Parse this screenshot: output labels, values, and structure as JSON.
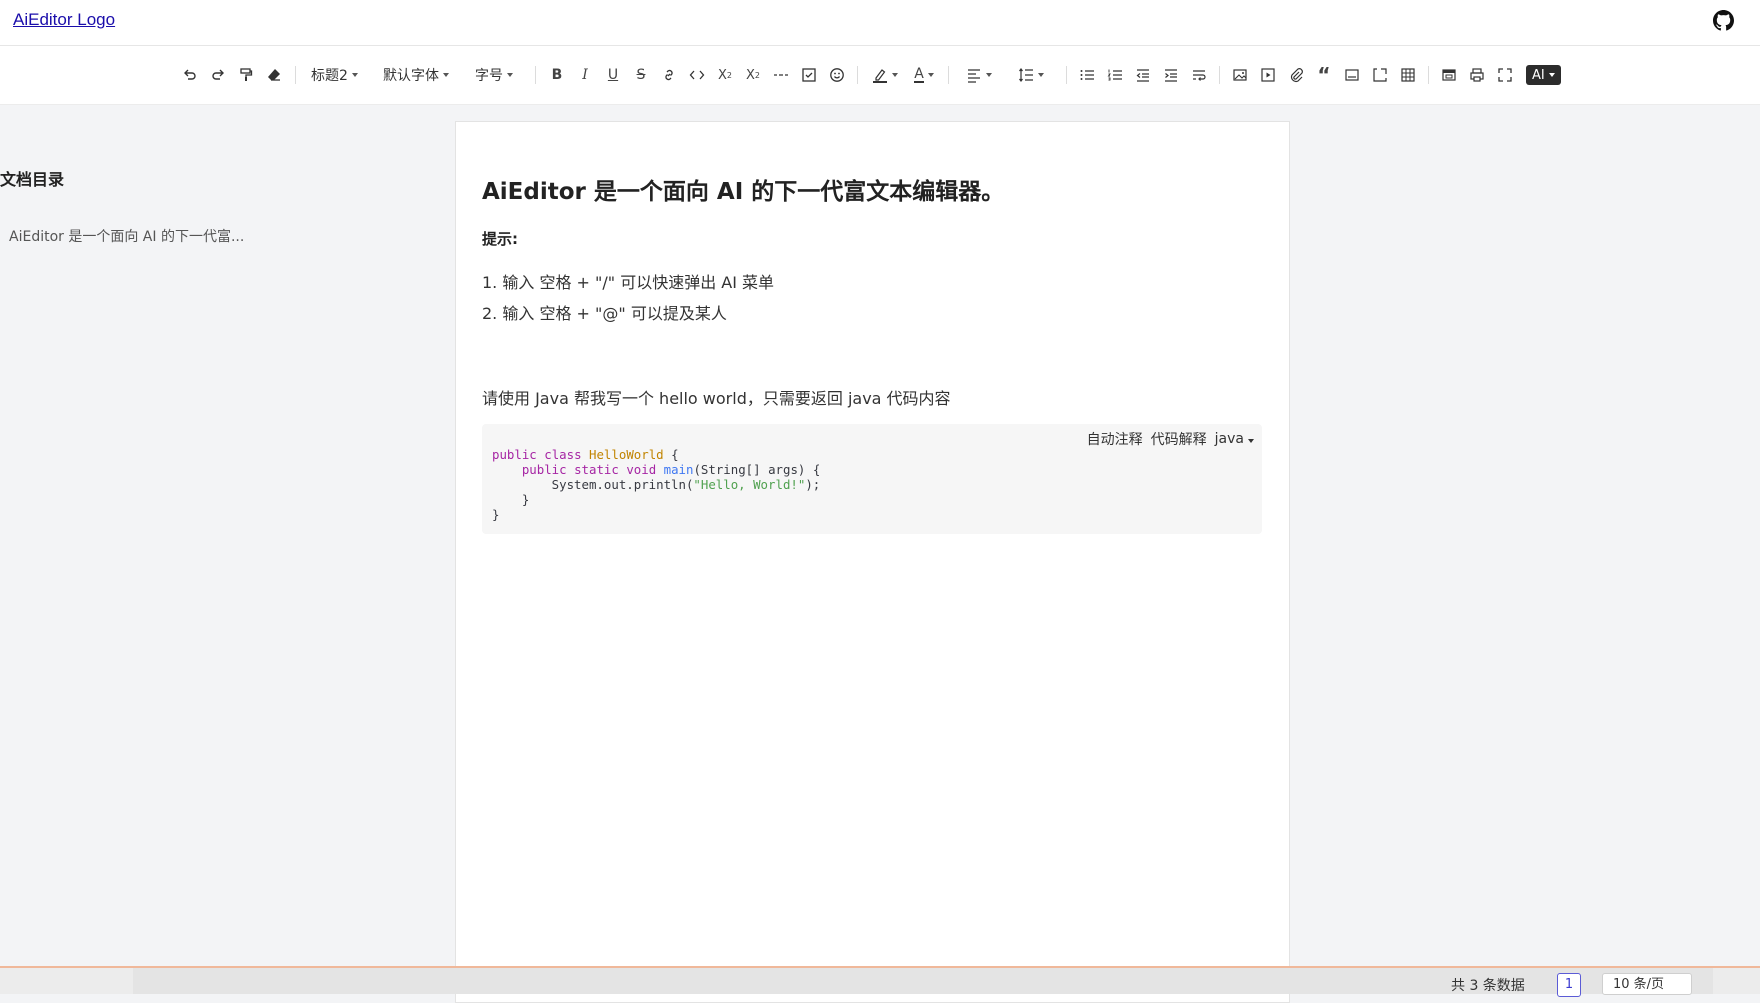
{
  "header": {
    "logo_text": "AiEditor Logo",
    "github_icon": "github-icon"
  },
  "toolbar": {
    "heading_select": "标题2",
    "font_family_select": "默认字体",
    "font_size_select": "字号",
    "ai_label": "AI",
    "icons": [
      "undo-icon",
      "redo-icon",
      "format-painter-icon",
      "eraser-icon",
      "bold-icon",
      "italic-icon",
      "underline-icon",
      "strike-icon",
      "link-icon",
      "code-icon",
      "subscript-icon",
      "superscript-icon",
      "hr-icon",
      "todo-icon",
      "emoji-icon",
      "highlight-icon",
      "font-color-icon",
      "align-icon",
      "line-height-icon",
      "bullet-list-icon",
      "ordered-list-icon",
      "indent-decrease-icon",
      "indent-increase-icon",
      "break-icon",
      "image-icon",
      "video-icon",
      "attachment-icon",
      "quote-icon",
      "container-icon",
      "code-block-icon",
      "table-icon",
      "printer-icon",
      "print-icon",
      "fullscreen-icon"
    ]
  },
  "toc": {
    "title": "文档目录",
    "items": [
      {
        "label": "AiEditor 是一个面向 AI 的下一代富..."
      }
    ]
  },
  "document": {
    "heading": "AiEditor 是一个面向 AI 的下一代富文本编辑器。",
    "tip_label": "提示:",
    "list": [
      "1. 输入 空格 + \"/\" 可以快速弹出 AI 菜单",
      "2. 输入 空格 + \"@\" 可以提及某人"
    ],
    "prompt": "请使用 Java 帮我写一个 hello world，只需要返回 java 代码内容",
    "code": {
      "action_comment": "自动注释",
      "action_explain": "代码解释",
      "language": "java",
      "lines": [
        "public class HelloWorld {",
        "    public static void main(String[] args) {",
        "        System.out.println(\"Hello, World!\");",
        "    }",
        "}"
      ]
    }
  },
  "footer": {
    "total": "共 3 条数据",
    "current_page": "1",
    "per_page": "10 条/页"
  }
}
